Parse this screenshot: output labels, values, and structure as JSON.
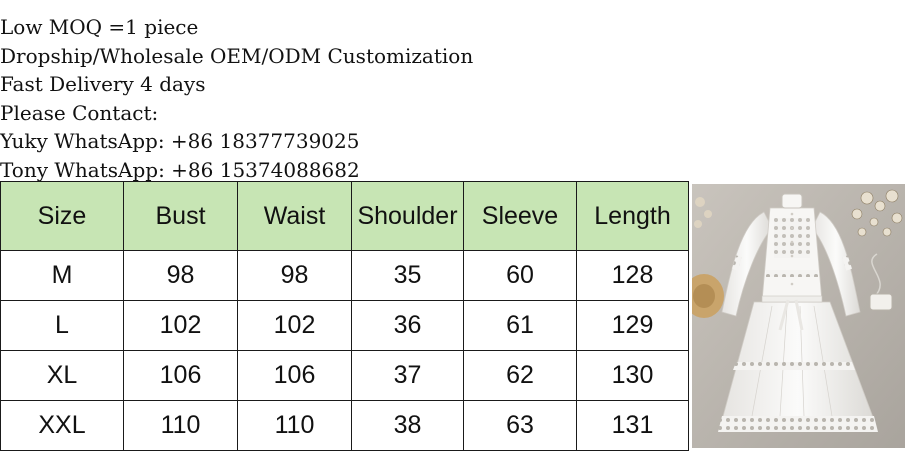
{
  "info_lines": [
    "Low MOQ =1 piece",
    "Dropship/Wholesale OEM/ODM Customization",
    "Fast Delivery 4 days",
    "Please Contact:",
    "Yuky WhatsApp: +86 18377739025",
    "Tony WhatsApp: +86 15374088682"
  ],
  "table": {
    "header_color": "#c7e5b4",
    "columns": [
      "Size",
      "Bust",
      "Waist",
      "Shoulder",
      "Sleeve",
      "Length"
    ],
    "rows": [
      [
        "M",
        "98",
        "98",
        "35",
        "60",
        "128"
      ],
      [
        "L",
        "102",
        "102",
        "36",
        "61",
        "129"
      ],
      [
        "XL",
        "106",
        "106",
        "37",
        "62",
        "130"
      ],
      [
        "XXL",
        "110",
        "110",
        "38",
        "63",
        "131"
      ]
    ]
  },
  "photo": {
    "subject": "white long-sleeve lace maxi dress",
    "props": [
      "straw-hat",
      "white-bag",
      "dried-flowers"
    ]
  }
}
